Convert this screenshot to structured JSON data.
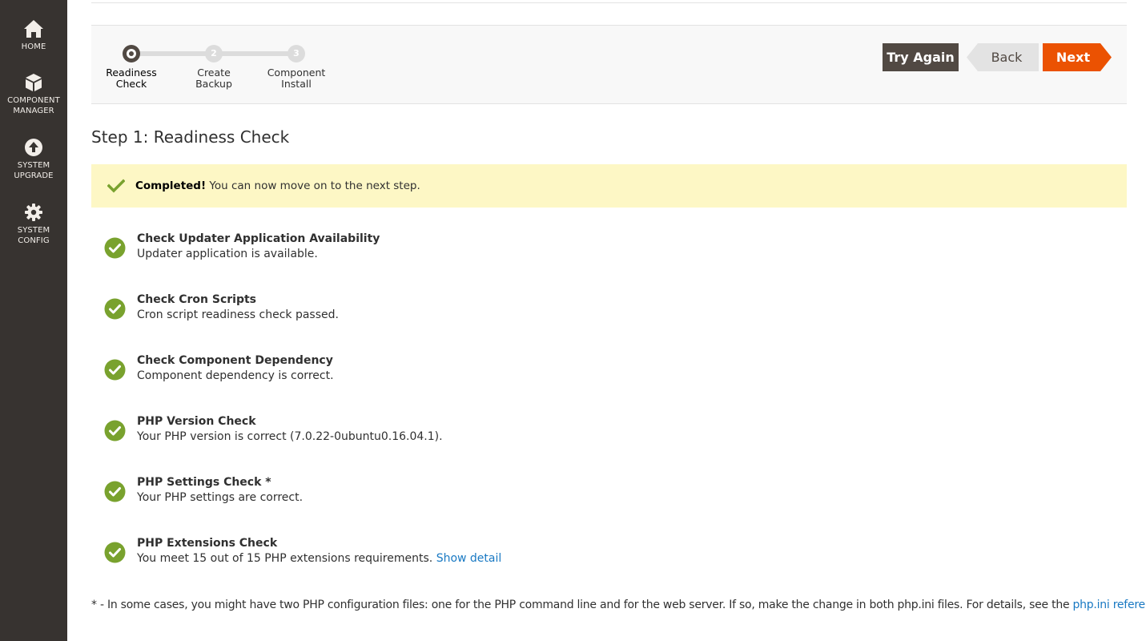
{
  "sidebar": {
    "items": [
      {
        "label_1": "HOME",
        "label_2": "",
        "icon": "home-icon"
      },
      {
        "label_1": "COMPONENT",
        "label_2": "MANAGER",
        "icon": "cube-icon"
      },
      {
        "label_1": "SYSTEM",
        "label_2": "UPGRADE",
        "icon": "upgrade-arrow-icon"
      },
      {
        "label_1": "SYSTEM",
        "label_2": "CONFIG",
        "icon": "gear-icon"
      }
    ]
  },
  "progress": {
    "steps": [
      {
        "number": "",
        "line1": "Readiness",
        "line2": "Check",
        "state": "active"
      },
      {
        "number": "2",
        "line1": "Create",
        "line2": "Backup",
        "state": "pending"
      },
      {
        "number": "3",
        "line1": "Component",
        "line2": "Install",
        "state": "pending"
      }
    ],
    "buttons": {
      "try_again": "Try Again",
      "back": "Back",
      "next": "Next"
    }
  },
  "page_title": "Step 1: Readiness Check",
  "message": {
    "strong": "Completed!",
    "text": " You can now move on to the next step.",
    "icon": "checkmark-icon"
  },
  "checks": [
    {
      "title": "Check Updater Application Availability",
      "description": "Updater application is available.",
      "link": ""
    },
    {
      "title": "Check Cron Scripts",
      "description": "Cron script readiness check passed.",
      "link": ""
    },
    {
      "title": "Check Component Dependency",
      "description": "Component dependency is correct.",
      "link": ""
    },
    {
      "title": "PHP Version Check",
      "description": "Your PHP version is correct (7.0.22-0ubuntu0.16.04.1).",
      "link": ""
    },
    {
      "title": "PHP Settings Check *",
      "description": "Your PHP settings are correct.",
      "link": ""
    },
    {
      "title": "PHP Extensions Check",
      "description": "You meet 15 out of 15 PHP extensions requirements. ",
      "link": "Show detail"
    }
  ],
  "footnote": {
    "text": "* - In some cases, you might have two PHP configuration files: one for the PHP command line and for the web server. If so, make the change in both php.ini files. For details, see the ",
    "link": "php.ini reference",
    "end": "."
  },
  "colors": {
    "sidebar": "#373330",
    "accent": "#eb5202",
    "success": "#79a22e",
    "message_bg": "#fdf7c5",
    "link": "#1979c3"
  }
}
